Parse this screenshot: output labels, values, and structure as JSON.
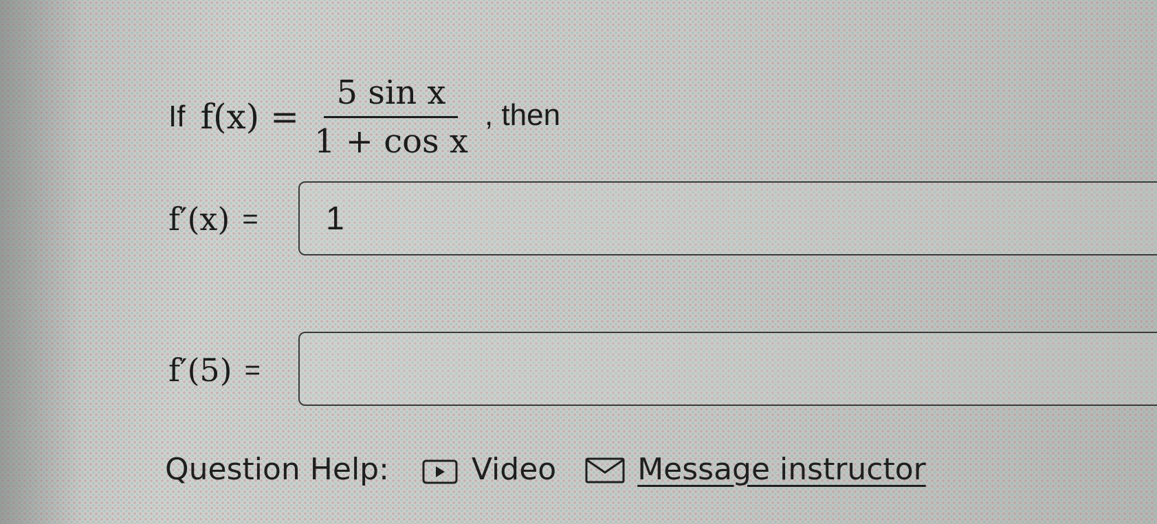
{
  "question": {
    "prefix": "If",
    "function_lhs": "f(x) =",
    "numerator": "5 sin x",
    "denominator": "1 + cos x",
    "suffix": ", then"
  },
  "answers": [
    {
      "label": "f′(x)",
      "equals": "=",
      "value": "1"
    },
    {
      "label": "f′(5)",
      "equals": "=",
      "value": ""
    }
  ],
  "help": {
    "label": "Question Help:",
    "video_label": "Video",
    "message_label": "Message instructor",
    "icons": [
      "video-icon",
      "mail-icon"
    ]
  }
}
